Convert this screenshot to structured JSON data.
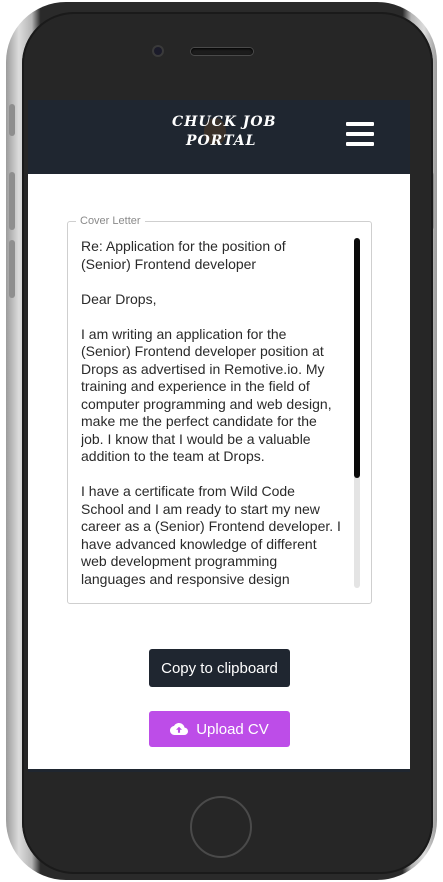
{
  "app": {
    "logo_line1": "CHUCK JOB",
    "logo_line2": "PORTAL"
  },
  "cover_letter": {
    "legend": "Cover Letter",
    "text": "Re: Application for the position of\n(Senior) Frontend developer\n\nDear Drops,\n\nI am writing an application for the\n(Senior) Frontend developer position at\nDrops as advertised in Remotive.io. My\ntraining and experience in the field of\ncomputer programming and web design,\nmake me the perfect candidate for the\njob. I know that I would be a valuable\naddition to the team at Drops.\n\nI have a certificate from Wild Code\nSchool and I am ready to start my new\ncareer as a (Senior) Frontend developer. I\nhave advanced knowledge of different\nweb development programming\nlanguages and responsive design"
  },
  "actions": {
    "copy_label": "Copy to clipboard",
    "upload_label": "Upload CV"
  },
  "colors": {
    "navbar": "#1f2630",
    "upload_accent": "#bd4de8",
    "copy_button": "#1f2630"
  },
  "icons": {
    "menu": "hamburger-menu-icon",
    "upload": "cloud-upload-icon"
  }
}
